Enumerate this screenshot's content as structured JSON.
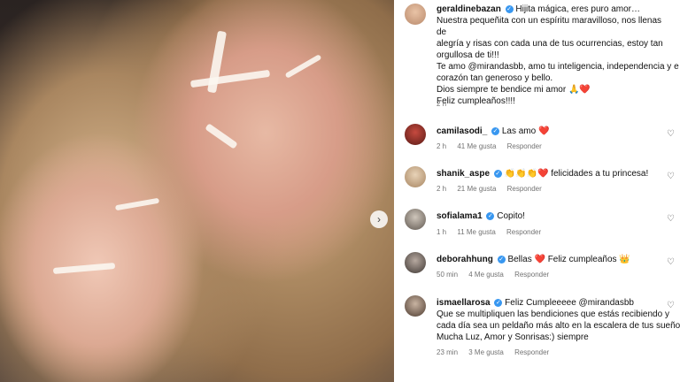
{
  "post": {
    "author": "geraldinebazan",
    "lines": [
      "Hijita mágica, eres puro amor…",
      "Nuestra pequeñita con un espíritu maravilloso, nos llenas de",
      "alegría y risas con cada una de tus ocurrencias, estoy tan",
      "orgullosa de ti!!!",
      "Te amo @mirandasbb, amo tu inteligencia, independencia y e",
      "corazón tan generoso y bello.",
      "Dios siempre te bendice mi amor 🙏❤️",
      "Feliz cumpleaños!!!!"
    ],
    "time": "2 h"
  },
  "comments": [
    {
      "user": "camilasodi_",
      "verified": true,
      "text": "Las amo ❤️",
      "time": "2 h",
      "likes": "41 Me gusta",
      "reply": "Responder"
    },
    {
      "user": "shanik_aspe",
      "verified": true,
      "text": "👏👏👏❤️ felicidades a tu princesa!",
      "time": "2 h",
      "likes": "21 Me gusta",
      "reply": "Responder"
    },
    {
      "user": "sofialama1",
      "verified": true,
      "text": "Copito!",
      "time": "1 h",
      "likes": "11 Me gusta",
      "reply": "Responder"
    },
    {
      "user": "deborahhung",
      "verified": true,
      "text": "Bellas ❤️ Feliz cumpleaños 👑",
      "time": "50 min",
      "likes": "4 Me gusta",
      "reply": "Responder"
    },
    {
      "user": "ismaellarosa",
      "verified": true,
      "text": "Feliz Cumpleeeee @mirandasbb",
      "extra": [
        "Que se multipliquen las bendiciones que estás recibiendo y",
        "cada día sea un peldaño más alto en la escalera de tus sueños",
        "Mucha Luz, Amor y Sonrisas:) siempre"
      ],
      "time": "23 min",
      "likes": "3 Me gusta",
      "reply": "Responder"
    }
  ],
  "icons": {
    "next": "chevron-right-icon",
    "heart": "heart-outline-icon",
    "verified": "verified-badge-icon"
  }
}
